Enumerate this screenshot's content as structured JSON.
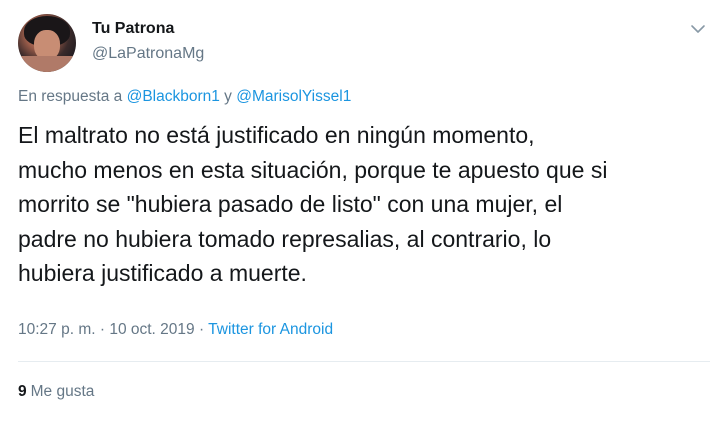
{
  "author": {
    "display_name": "Tu Patrona",
    "handle": "@LaPatronaMg"
  },
  "icons": {
    "menu": "chevron-down-icon",
    "avatar": "profile-photo"
  },
  "reply": {
    "prefix": "En respuesta a ",
    "mention_1": "@Blackborn1",
    "joiner": " y ",
    "mention_2": "@MarisolYissel1"
  },
  "tweet": {
    "lines": [
      "El maltrato no está justificado en ningún momento,",
      "mucho menos en esta situación, porque te apuesto que si",
      "morrito se \"hubiera pasado de listo\" con una mujer, el",
      "padre no hubiera tomado represalias, al contrario, lo",
      "hubiera justificado a muerte."
    ]
  },
  "meta": {
    "time": "10:27 p. m.",
    "sep1": " · ",
    "date": "10 oct. 2019",
    "sep2": " · ",
    "source": "Twitter for Android"
  },
  "stats": {
    "likes_count": "9",
    "likes_label": "Me gusta"
  },
  "colors": {
    "text": "#14171a",
    "secondary": "#657786",
    "link": "#1b95e0",
    "divider": "#e6ecf0"
  }
}
